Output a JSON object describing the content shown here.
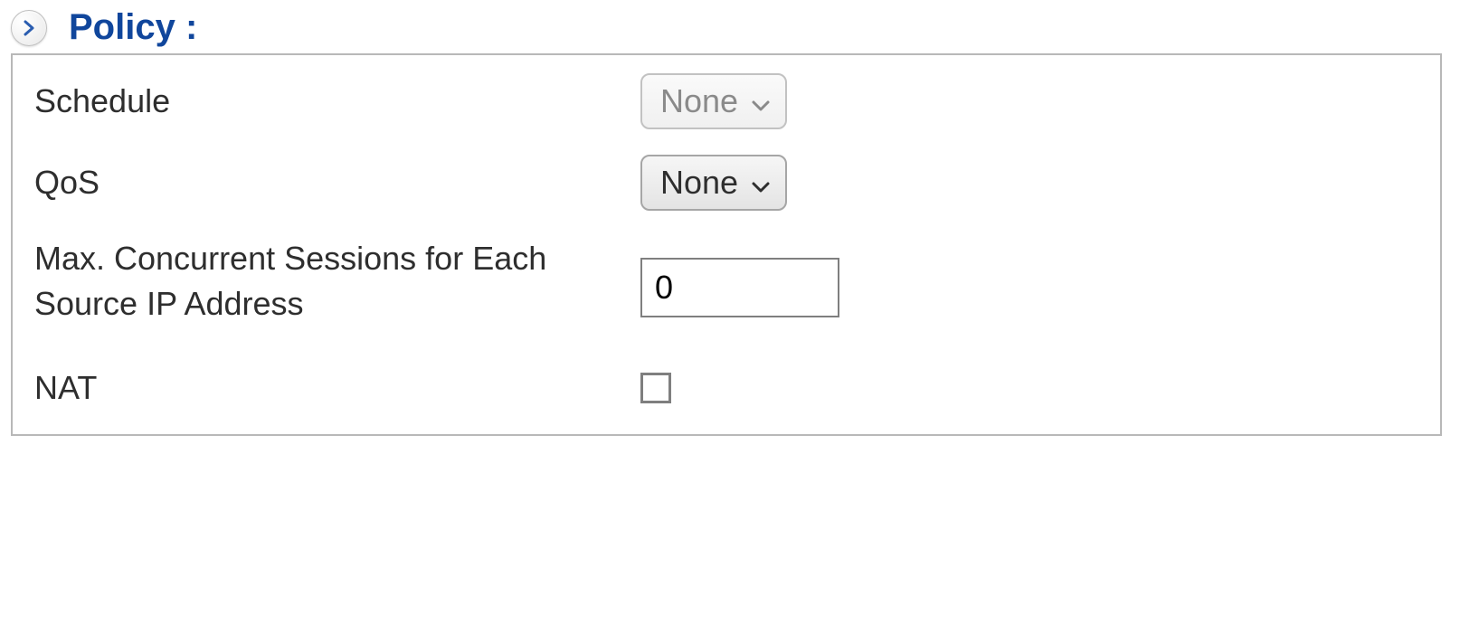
{
  "section": {
    "title": "Policy :"
  },
  "fields": {
    "schedule": {
      "label": "Schedule",
      "value": "None"
    },
    "qos": {
      "label": "QoS",
      "value": "None"
    },
    "max_sessions": {
      "label": "Max. Concurrent Sessions for Each Source IP Address",
      "value": "0"
    },
    "nat": {
      "label": "NAT",
      "checked": false
    }
  }
}
